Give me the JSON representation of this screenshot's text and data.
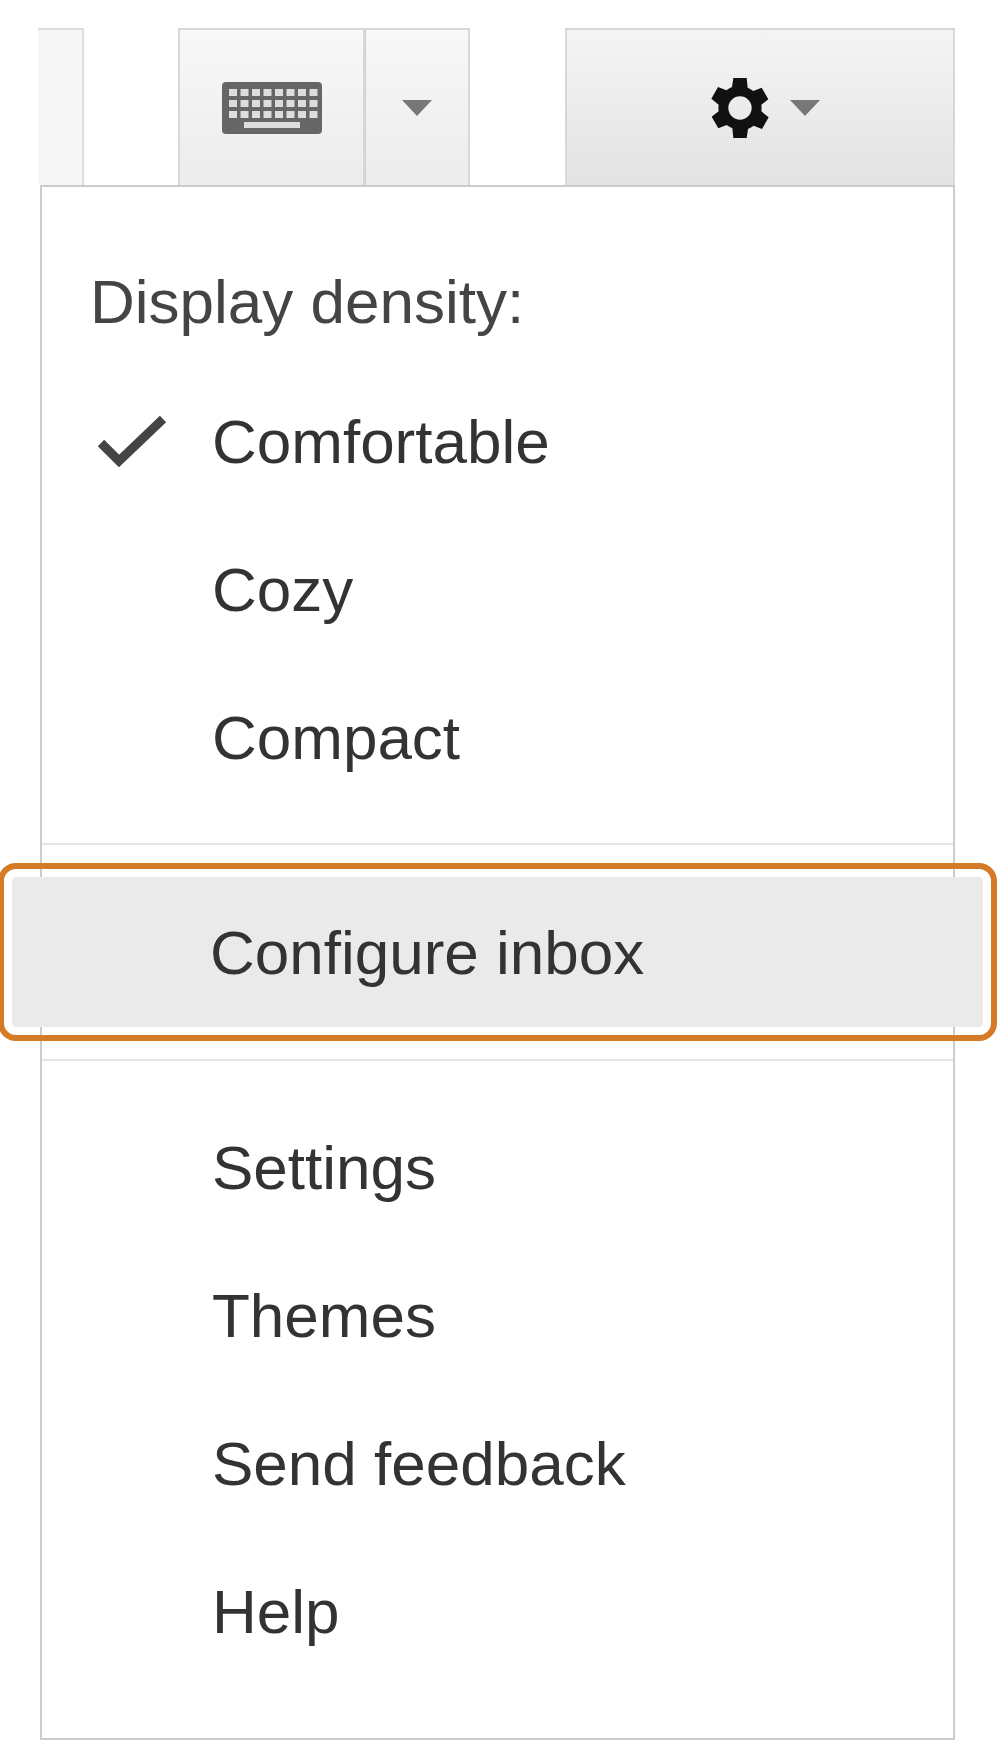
{
  "menu": {
    "heading": "Display density:",
    "density_options": [
      {
        "label": "Comfortable",
        "checked": true
      },
      {
        "label": "Cozy",
        "checked": false
      },
      {
        "label": "Compact",
        "checked": false
      }
    ],
    "configure_item": {
      "label": "Configure inbox",
      "highlighted": true
    },
    "items": [
      {
        "label": "Settings"
      },
      {
        "label": "Themes"
      },
      {
        "label": "Send feedback"
      },
      {
        "label": "Help"
      }
    ]
  }
}
